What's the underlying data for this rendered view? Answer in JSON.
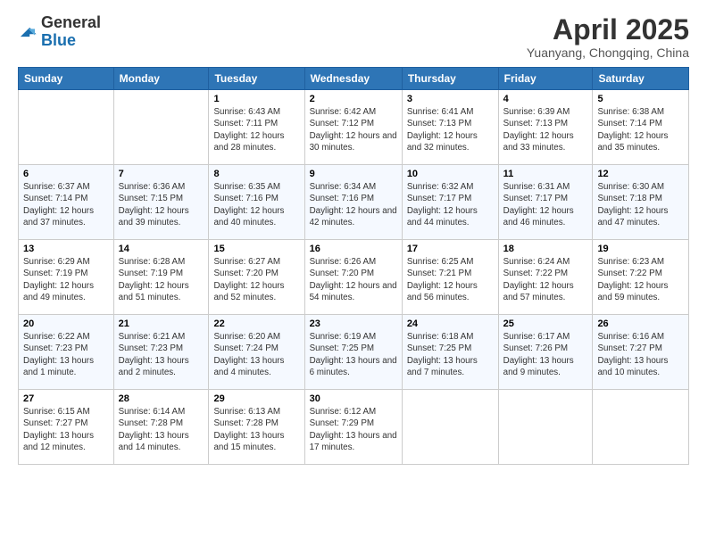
{
  "header": {
    "logo_general": "General",
    "logo_blue": "Blue",
    "month_title": "April 2025",
    "location": "Yuanyang, Chongqing, China"
  },
  "days_of_week": [
    "Sunday",
    "Monday",
    "Tuesday",
    "Wednesday",
    "Thursday",
    "Friday",
    "Saturday"
  ],
  "weeks": [
    [
      {
        "day": "",
        "info": ""
      },
      {
        "day": "",
        "info": ""
      },
      {
        "day": "1",
        "info": "Sunrise: 6:43 AM\nSunset: 7:11 PM\nDaylight: 12 hours and 28 minutes."
      },
      {
        "day": "2",
        "info": "Sunrise: 6:42 AM\nSunset: 7:12 PM\nDaylight: 12 hours and 30 minutes."
      },
      {
        "day": "3",
        "info": "Sunrise: 6:41 AM\nSunset: 7:13 PM\nDaylight: 12 hours and 32 minutes."
      },
      {
        "day": "4",
        "info": "Sunrise: 6:39 AM\nSunset: 7:13 PM\nDaylight: 12 hours and 33 minutes."
      },
      {
        "day": "5",
        "info": "Sunrise: 6:38 AM\nSunset: 7:14 PM\nDaylight: 12 hours and 35 minutes."
      }
    ],
    [
      {
        "day": "6",
        "info": "Sunrise: 6:37 AM\nSunset: 7:14 PM\nDaylight: 12 hours and 37 minutes."
      },
      {
        "day": "7",
        "info": "Sunrise: 6:36 AM\nSunset: 7:15 PM\nDaylight: 12 hours and 39 minutes."
      },
      {
        "day": "8",
        "info": "Sunrise: 6:35 AM\nSunset: 7:16 PM\nDaylight: 12 hours and 40 minutes."
      },
      {
        "day": "9",
        "info": "Sunrise: 6:34 AM\nSunset: 7:16 PM\nDaylight: 12 hours and 42 minutes."
      },
      {
        "day": "10",
        "info": "Sunrise: 6:32 AM\nSunset: 7:17 PM\nDaylight: 12 hours and 44 minutes."
      },
      {
        "day": "11",
        "info": "Sunrise: 6:31 AM\nSunset: 7:17 PM\nDaylight: 12 hours and 46 minutes."
      },
      {
        "day": "12",
        "info": "Sunrise: 6:30 AM\nSunset: 7:18 PM\nDaylight: 12 hours and 47 minutes."
      }
    ],
    [
      {
        "day": "13",
        "info": "Sunrise: 6:29 AM\nSunset: 7:19 PM\nDaylight: 12 hours and 49 minutes."
      },
      {
        "day": "14",
        "info": "Sunrise: 6:28 AM\nSunset: 7:19 PM\nDaylight: 12 hours and 51 minutes."
      },
      {
        "day": "15",
        "info": "Sunrise: 6:27 AM\nSunset: 7:20 PM\nDaylight: 12 hours and 52 minutes."
      },
      {
        "day": "16",
        "info": "Sunrise: 6:26 AM\nSunset: 7:20 PM\nDaylight: 12 hours and 54 minutes."
      },
      {
        "day": "17",
        "info": "Sunrise: 6:25 AM\nSunset: 7:21 PM\nDaylight: 12 hours and 56 minutes."
      },
      {
        "day": "18",
        "info": "Sunrise: 6:24 AM\nSunset: 7:22 PM\nDaylight: 12 hours and 57 minutes."
      },
      {
        "day": "19",
        "info": "Sunrise: 6:23 AM\nSunset: 7:22 PM\nDaylight: 12 hours and 59 minutes."
      }
    ],
    [
      {
        "day": "20",
        "info": "Sunrise: 6:22 AM\nSunset: 7:23 PM\nDaylight: 13 hours and 1 minute."
      },
      {
        "day": "21",
        "info": "Sunrise: 6:21 AM\nSunset: 7:23 PM\nDaylight: 13 hours and 2 minutes."
      },
      {
        "day": "22",
        "info": "Sunrise: 6:20 AM\nSunset: 7:24 PM\nDaylight: 13 hours and 4 minutes."
      },
      {
        "day": "23",
        "info": "Sunrise: 6:19 AM\nSunset: 7:25 PM\nDaylight: 13 hours and 6 minutes."
      },
      {
        "day": "24",
        "info": "Sunrise: 6:18 AM\nSunset: 7:25 PM\nDaylight: 13 hours and 7 minutes."
      },
      {
        "day": "25",
        "info": "Sunrise: 6:17 AM\nSunset: 7:26 PM\nDaylight: 13 hours and 9 minutes."
      },
      {
        "day": "26",
        "info": "Sunrise: 6:16 AM\nSunset: 7:27 PM\nDaylight: 13 hours and 10 minutes."
      }
    ],
    [
      {
        "day": "27",
        "info": "Sunrise: 6:15 AM\nSunset: 7:27 PM\nDaylight: 13 hours and 12 minutes."
      },
      {
        "day": "28",
        "info": "Sunrise: 6:14 AM\nSunset: 7:28 PM\nDaylight: 13 hours and 14 minutes."
      },
      {
        "day": "29",
        "info": "Sunrise: 6:13 AM\nSunset: 7:28 PM\nDaylight: 13 hours and 15 minutes."
      },
      {
        "day": "30",
        "info": "Sunrise: 6:12 AM\nSunset: 7:29 PM\nDaylight: 13 hours and 17 minutes."
      },
      {
        "day": "",
        "info": ""
      },
      {
        "day": "",
        "info": ""
      },
      {
        "day": "",
        "info": ""
      }
    ]
  ]
}
